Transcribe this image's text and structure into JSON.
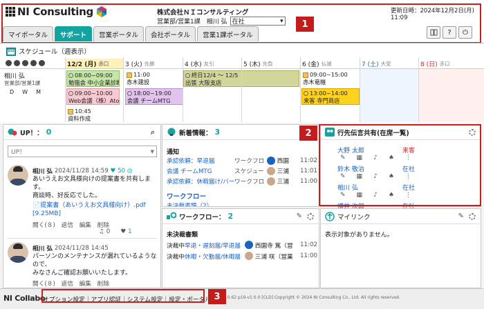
{
  "header": {
    "logo_text": "NI Consulting",
    "company": "株式会社ＮＩコンサルティング",
    "dept_user": "営業部/営業1課　相川 弘",
    "status_value": "在社",
    "updated": "更新日時：2024年12月2日(月) 11:09",
    "tabs": [
      "マイポータル",
      "サポート",
      "営業ポータル",
      "会社ポータル",
      "営業1課ポータル"
    ],
    "active_tab": "サポート",
    "badge1": "1",
    "badge2": "2",
    "badge3": "3"
  },
  "schedule": {
    "title": "スケジュール（週表示）",
    "days": [
      {
        "label": "12/2 (月)",
        "sub": "赤口",
        "color": "#222"
      },
      {
        "label": "3 (火)",
        "sub": "先勝",
        "color": "#222"
      },
      {
        "label": "4 (水)",
        "sub": "友引",
        "color": "#222"
      },
      {
        "label": "5 (木)",
        "sub": "先負",
        "color": "#222"
      },
      {
        "label": "6 (金)",
        "sub": "仏滅",
        "color": "#222"
      },
      {
        "label": "7 (土)",
        "sub": "大安",
        "color": "#1a62c0"
      },
      {
        "label": "8 (日)",
        "sub": "赤口",
        "color": "#d62020"
      }
    ],
    "person_name": "相川 弘",
    "person_dept": "営業部/営業1課",
    "view_buttons": [
      "D",
      "W",
      "M"
    ],
    "events": {
      "mon1": "08:00~09:00",
      "mon1b": "勉強会 中小企業診断士",
      "mon2": "09:00~10:00",
      "mon2b": "Web会議（株）AtoZ",
      "mon3": "10:45",
      "mon3b": "資料作成",
      "tue1": "11:00",
      "tue1b": "赤木建設",
      "tue2": "18:00~19:00",
      "tue2b": "会議 チームMTG",
      "wed1": "終日12/4 ～ 12/5",
      "wed1b": "出張 大阪支店",
      "fri1": "09:00~15:00",
      "fri1b": "赤木竜機",
      "fri2": "13:00~14:00",
      "fri2b": "来客 寺門商店"
    }
  },
  "up": {
    "title": "UP！：",
    "count": "0",
    "input_placeholder": "UP！",
    "posts": [
      {
        "name": "相川 弘",
        "date": "2024/11/28 14:59",
        "likes": "50",
        "text1": "あいうえお文具様向けの提案書を共有しま",
        "text2": "す。",
        "text3": "商談時、好反応でした。",
        "attach": "提案書（あいうえお文具様向け）.pdf",
        "attach_size": "[9.25MB]",
        "actions": "開く(８)　返信　編集　削除",
        "replies": "0",
        "hearts": "1"
      },
      {
        "name": "相川 弘",
        "date": "2024/11/28 14:45",
        "text1": "パーソンのメンテナンスが漏れているような",
        "text2": "ので、",
        "text3": "みなさんご確認お願いいたします。",
        "actions": "開く(８)　返信　編集　削除"
      }
    ]
  },
  "news": {
    "title": "新着情報：",
    "count": "3",
    "section1": "通知",
    "items": [
      {
        "title": "承認依頼：早退届",
        "type": "ワークフロ",
        "user": "西園",
        "time": "11:02"
      },
      {
        "title": "会議 チームMTG",
        "type": "スケジュー",
        "user": "三浦",
        "time": "11:01"
      },
      {
        "title": "承認依頼：休暇届け/バー",
        "type": "ワークフロ",
        "user": "三浦",
        "time": "11:00"
      }
    ],
    "section2": "ワークフロー",
    "cut_item": "未決裁書類（2）"
  },
  "dengon": {
    "title": "行先伝言共有(在席一覧)",
    "people": [
      {
        "name": "大野 太郎",
        "status": "来客",
        "status_color": "#d62020"
      },
      {
        "name": "鈴木 敬治",
        "status": "在社",
        "status_color": "#1a62c0"
      },
      {
        "name": "相川 弘",
        "status": "在社",
        "status_color": "#1a62c0"
      },
      {
        "name": "横井 次郎",
        "status": "在社",
        "status_color": "#1a62c0"
      }
    ]
  },
  "workflow": {
    "title": "ワークフロー：",
    "count": "2",
    "section": "未決裁書類",
    "items": [
      {
        "label": "決裁中",
        "link": "早退・遅刻届/早退届",
        "user": "西園寺 篤（営",
        "time": "11:02"
      },
      {
        "label": "決裁中",
        "link": "休暇・欠勤届/休暇届",
        "user": "三浦 咲（営業",
        "time": "11:00"
      }
    ]
  },
  "mylink": {
    "title": "マイリンク",
    "empty": "表示対象がありません。"
  },
  "footer": {
    "logo": "NI Collabo",
    "links": "オプション設定｜アプリ認証｜システム設定｜設定・ポータル",
    "version": "s 8.0.62 p19-v1.0.0 [CLD] Copyright © 2024 NI Consulting Co., Ltd. All rights reserved."
  }
}
